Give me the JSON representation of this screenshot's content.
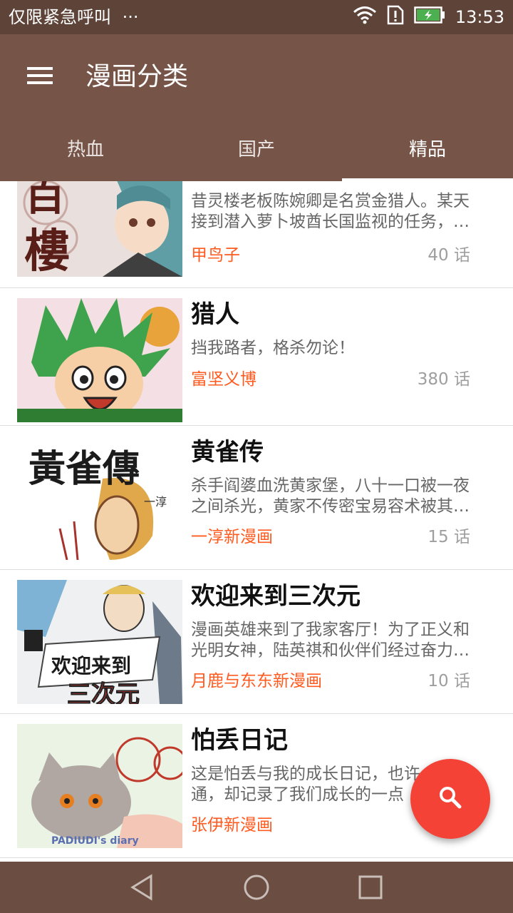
{
  "status_bar": {
    "left_text": "仅限紧急呼叫",
    "more": "···",
    "time": "13:53",
    "icons": [
      "wifi-icon",
      "sim-alert-icon",
      "battery-charging-icon"
    ]
  },
  "app_bar": {
    "title": "漫画分类",
    "menu_icon": "hamburger-menu-icon"
  },
  "tabs": [
    {
      "label": "热血",
      "active": false
    },
    {
      "label": "国产",
      "active": false
    },
    {
      "label": "精品",
      "active": true
    }
  ],
  "comics": [
    {
      "title": "",
      "desc_lines": [
        "昔灵楼老板陈婉卿是名赏金猎人。某天",
        "接到潜入萝卜坡酋长国监视的任务，…"
      ],
      "author": "甲鸟子",
      "chapters": "40 话"
    },
    {
      "title": "猎人",
      "desc_lines": [
        "挡我路者，格杀勿论！"
      ],
      "author": "富坚义博",
      "chapters": "380 话"
    },
    {
      "title": "黄雀传",
      "desc_lines": [
        "杀手阎婆血洗黄家堡，八十一口被一夜",
        "之间杀光，黄家不传密宝易容术被其…"
      ],
      "author": "一淳新漫画",
      "chapters": "15 话"
    },
    {
      "title": "欢迎来到三次元",
      "desc_lines": [
        "漫画英雄来到了我家客厅！为了正义和",
        "光明女神，陆英祺和伙伴们经过奋力…"
      ],
      "author": "月鹿与东东新漫画",
      "chapters": "10 话"
    },
    {
      "title": "怕丢日记",
      "desc_lines": [
        "这是怕丢与我的成长日记，也许",
        "通，却记录了我们成长的一点"
      ],
      "author": "张伊新漫画",
      "chapters": ""
    }
  ],
  "covers": {
    "c0": {
      "t1": "百",
      "t2": "樓"
    },
    "c2": {
      "t1": "黃雀傳",
      "t2": "一淳"
    },
    "c3": {
      "t1": "欢迎来到",
      "t2": "三次元"
    },
    "c4": {
      "t1": "PADIUDI's diary"
    }
  },
  "fab": {
    "icon": "search-icon"
  },
  "nav_bar": {
    "icons": [
      "back-triangle-icon",
      "home-circle-icon",
      "recents-square-icon"
    ]
  },
  "colors": {
    "status_bar": "#5e4338",
    "app_bar": "#765548",
    "accent_author": "#ff5a1f",
    "fab": "#f44336",
    "nav_bar": "#6b4d42"
  }
}
